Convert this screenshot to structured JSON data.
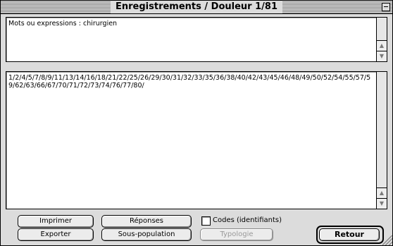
{
  "window": {
    "title": "Enregistrements / Douleur 1/81"
  },
  "query_box": {
    "text": "Mots ou expressions : chirurgien"
  },
  "results_box": {
    "text": "1/2/4/5/7/8/9/11/13/14/16/18/21/22/25/26/29/30/31/32/33/35/36/38/40/42/43/45/46/48/49/50/52/54/55/57/59/62/63/66/67/70/71/72/73/74/76/77/80/"
  },
  "buttons": {
    "imprimer": "Imprimer",
    "reponses": "Réponses",
    "exporter": "Exporter",
    "sous_population": "Sous-population",
    "typologie": "Typologie",
    "retour": "Retour"
  },
  "checkbox": {
    "codes_label": "Codes (identifiants)",
    "checked": false
  },
  "icons": {
    "scroll_up": "scroll-up-arrow",
    "scroll_down": "scroll-down-arrow",
    "collapse": "collapse-box",
    "resize": "grow-box"
  }
}
